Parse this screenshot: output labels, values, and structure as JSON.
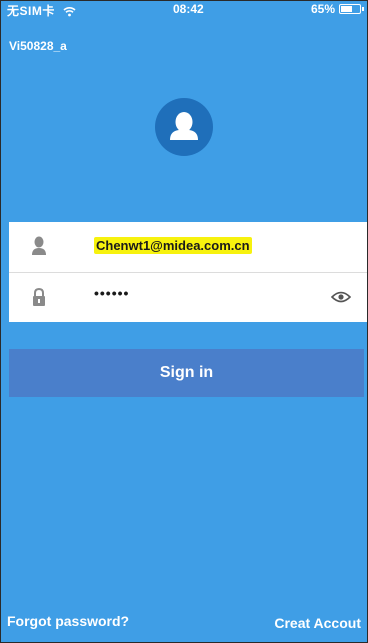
{
  "status_bar": {
    "carrier": "无SIM卡",
    "time": "08:42",
    "battery": "65%",
    "battery_level": 0.65
  },
  "device": {
    "name": "Vi50828_a"
  },
  "login": {
    "email_value": "Chenwt1@midea.com.cn",
    "password_value": "••••••",
    "signin_label": "Sign in"
  },
  "footer": {
    "forgot_label": "Forgot password?",
    "create_label": "Creat Accout"
  },
  "colors": {
    "background": "#3f9ee6",
    "avatar": "#1f6fba",
    "button": "#4a7fcb",
    "highlight": "#f7f20e"
  },
  "icons": [
    "wifi-icon",
    "battery-icon",
    "avatar-icon",
    "user-icon",
    "lock-icon",
    "eye-icon"
  ]
}
